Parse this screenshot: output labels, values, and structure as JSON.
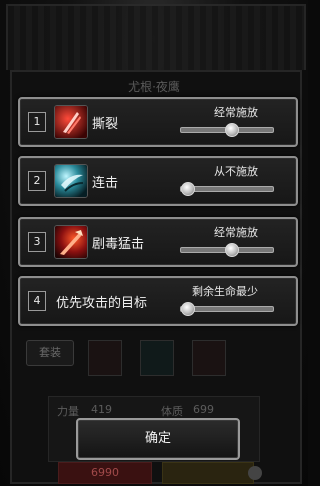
{
  "background": {
    "title": "尤根·夜鹰",
    "rest_label": "套装",
    "stats": {
      "strength_label": "力量",
      "strength_value": "419",
      "constitution_label": "体质",
      "constitution_value": "699"
    },
    "bottom_left_value": "6990"
  },
  "settings": [
    {
      "number": "1",
      "name": "撕裂",
      "mode": "经常施放",
      "level": 0.55,
      "icon": "rend-skill-icon"
    },
    {
      "number": "2",
      "name": "连击",
      "mode": "从不施放",
      "level": 0.0,
      "icon": "combo-strike-icon"
    },
    {
      "number": "3",
      "name": "剧毒猛击",
      "mode": "经常施放",
      "level": 0.55,
      "icon": "venom-strike-icon"
    },
    {
      "number": "4",
      "name": "优先攻击的目标",
      "mode": "剩余生命最少",
      "level": 0.0
    }
  ],
  "confirm_label": "确定",
  "colors": {
    "row_border": "#8e8e8e",
    "skill_red": "#c81e1e",
    "skill_teal": "#2a8a9a"
  }
}
